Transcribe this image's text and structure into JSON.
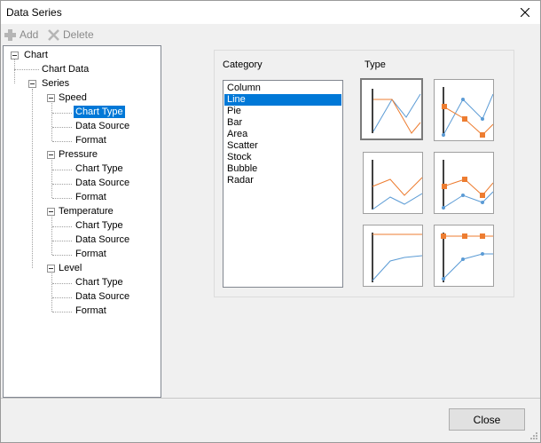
{
  "window": {
    "title": "Data Series"
  },
  "toolbar": {
    "add_label": "Add",
    "delete_label": "Delete"
  },
  "tree": {
    "root": "Chart",
    "chart_data": "Chart Data",
    "series": "Series",
    "series_items": [
      {
        "name": "Speed",
        "children": [
          "Chart Type",
          "Data Source",
          "Format"
        ]
      },
      {
        "name": "Pressure",
        "children": [
          "Chart Type",
          "Data Source",
          "Format"
        ]
      },
      {
        "name": "Temperature",
        "children": [
          "Chart Type",
          "Data Source",
          "Format"
        ]
      },
      {
        "name": "Level",
        "children": [
          "Chart Type",
          "Data Source",
          "Format"
        ]
      }
    ],
    "selected": "Speed / Chart Type"
  },
  "category": {
    "label": "Category",
    "items": [
      "Column",
      "Line",
      "Pie",
      "Bar",
      "Area",
      "Scatter",
      "Stock",
      "Bubble",
      "Radar"
    ],
    "selected": "Line"
  },
  "type": {
    "label": "Type",
    "thumbnails": [
      "line",
      "line-with-markers",
      "stacked-line",
      "stacked-line-with-markers",
      "percent-line",
      "percent-line-with-markers"
    ],
    "selected": "line"
  },
  "footer": {
    "close_label": "Close"
  },
  "colors": {
    "accent": "#0078d7",
    "series_blue": "#5b9bd5",
    "series_orange": "#ed7d31"
  },
  "icons": {
    "add": "plus-icon",
    "delete": "x-icon",
    "close": "close-icon"
  }
}
